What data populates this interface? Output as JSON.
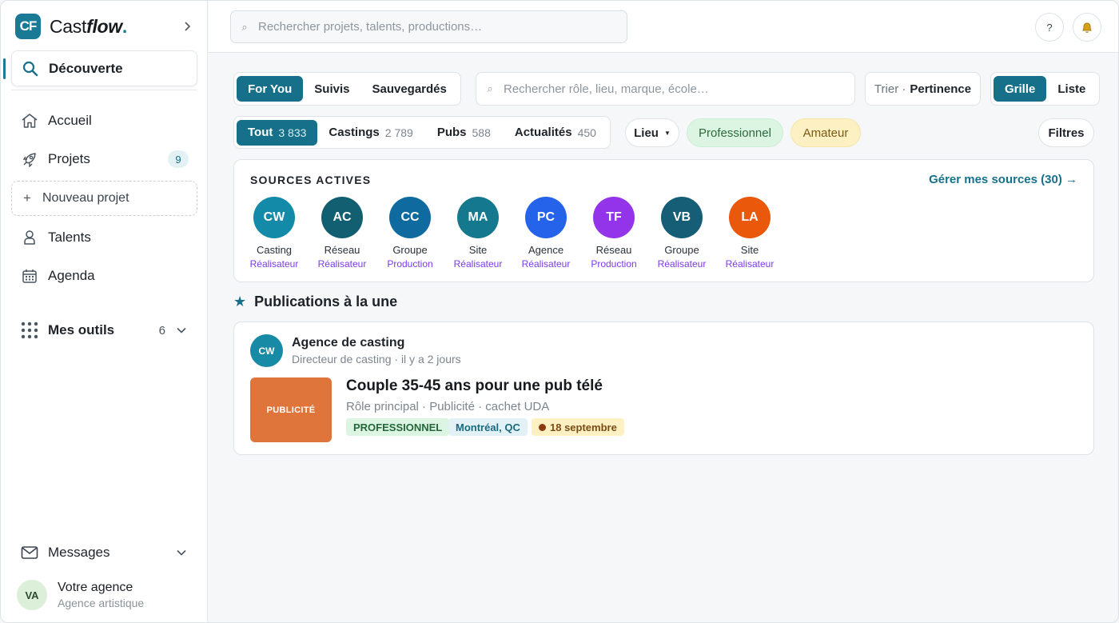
{
  "brand": {
    "mark": "CF",
    "name_light": "Cast",
    "name_bold": "flow",
    "name_dot": "."
  },
  "sidebar": {
    "items": [
      {
        "label": "Découverte"
      },
      {
        "label": "Accueil"
      },
      {
        "label": "Projets",
        "badge": "9"
      },
      {
        "label": "Nouveau projet"
      },
      {
        "label": "Talents"
      },
      {
        "label": "Agenda"
      },
      {
        "label": "Mes outils",
        "count": "6"
      },
      {
        "label": "Messages"
      }
    ],
    "user": {
      "initials": "VA",
      "name": "Votre agence",
      "role": "Agence artistique"
    }
  },
  "topbar": {
    "search_placeholder": "Rechercher projets, talents, productions…",
    "help": "?"
  },
  "feed_tabs": [
    "For You",
    "Suivis",
    "Sauvegardés"
  ],
  "role_search_placeholder": "Rechercher rôle, lieu, marque, école…",
  "sort": {
    "prefix": "Trier ·",
    "value": "Pertinence"
  },
  "view_toggle": [
    "Grille",
    "Liste"
  ],
  "type_tabs": [
    {
      "label": "Tout",
      "count": "3 833"
    },
    {
      "label": "Castings",
      "count": "2 789"
    },
    {
      "label": "Pubs",
      "count": "588"
    },
    {
      "label": "Actualités",
      "count": "450"
    }
  ],
  "filters": {
    "lieu": "Lieu",
    "professionnel": "Professionnel",
    "amateur": "Amateur",
    "filtres": "Filtres"
  },
  "sources": {
    "title": "SOURCES ACTIVES",
    "manage_link": "Gérer mes sources (30) →",
    "items": [
      {
        "initials": "CW",
        "name": "Casting",
        "role": "Réalisateur",
        "color": "#138ba8"
      },
      {
        "initials": "AC",
        "name": "Réseau",
        "role": "Réalisateur",
        "color": "#125f72"
      },
      {
        "initials": "CC",
        "name": "Groupe",
        "role": "Production",
        "color": "#0f6aa0"
      },
      {
        "initials": "MA",
        "name": "Site",
        "role": "Réalisateur",
        "color": "#14788f"
      },
      {
        "initials": "PC",
        "name": "Agence",
        "role": "Réalisateur",
        "color": "#2563eb"
      },
      {
        "initials": "TF",
        "name": "Réseau",
        "role": "Production",
        "color": "#9333ea"
      },
      {
        "initials": "VB",
        "name": "Groupe",
        "role": "Réalisateur",
        "color": "#155e75"
      },
      {
        "initials": "LA",
        "name": "Site",
        "role": "Réalisateur",
        "color": "#ea580c"
      }
    ]
  },
  "featured": {
    "title": "Publications à la une",
    "post": {
      "avatar": "CW",
      "author": "Agence de casting",
      "meta": "Directeur de casting · il y a 2 jours",
      "thumb_label": "PUBLICITÉ",
      "title": "Couple 35-45 ans pour une pub télé",
      "subtitle": "Rôle principal · Publicité · cachet UDA",
      "tags": [
        "PROFESSIONNEL",
        "Montréal, QC",
        "18 septembre"
      ]
    }
  }
}
